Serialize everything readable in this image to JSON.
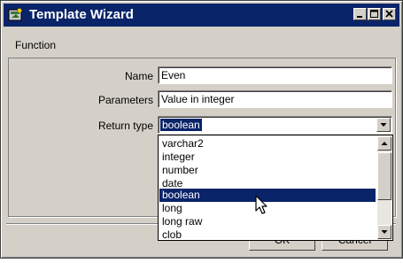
{
  "window": {
    "title": "Template Wizard",
    "icon": "wizard-app-icon",
    "controls": [
      "minimize-icon",
      "maximize-icon",
      "close-icon"
    ]
  },
  "section_label": "Function",
  "form": {
    "name_label": "Name",
    "name_value": "Even",
    "parameters_label": "Parameters",
    "parameters_value": "Value in integer",
    "return_type_label": "Return type",
    "return_type_value": "boolean"
  },
  "dropdown": {
    "options": [
      "varchar2",
      "integer",
      "number",
      "date",
      "boolean",
      "long",
      "long raw",
      "clob"
    ],
    "selected": "boolean"
  },
  "buttons": {
    "ok_label": "OK",
    "cancel_label": "Cancel"
  },
  "colors": {
    "titlebar": "#0a246a",
    "selection": "#0a246a",
    "dialog_bg": "#d4d0c8"
  }
}
